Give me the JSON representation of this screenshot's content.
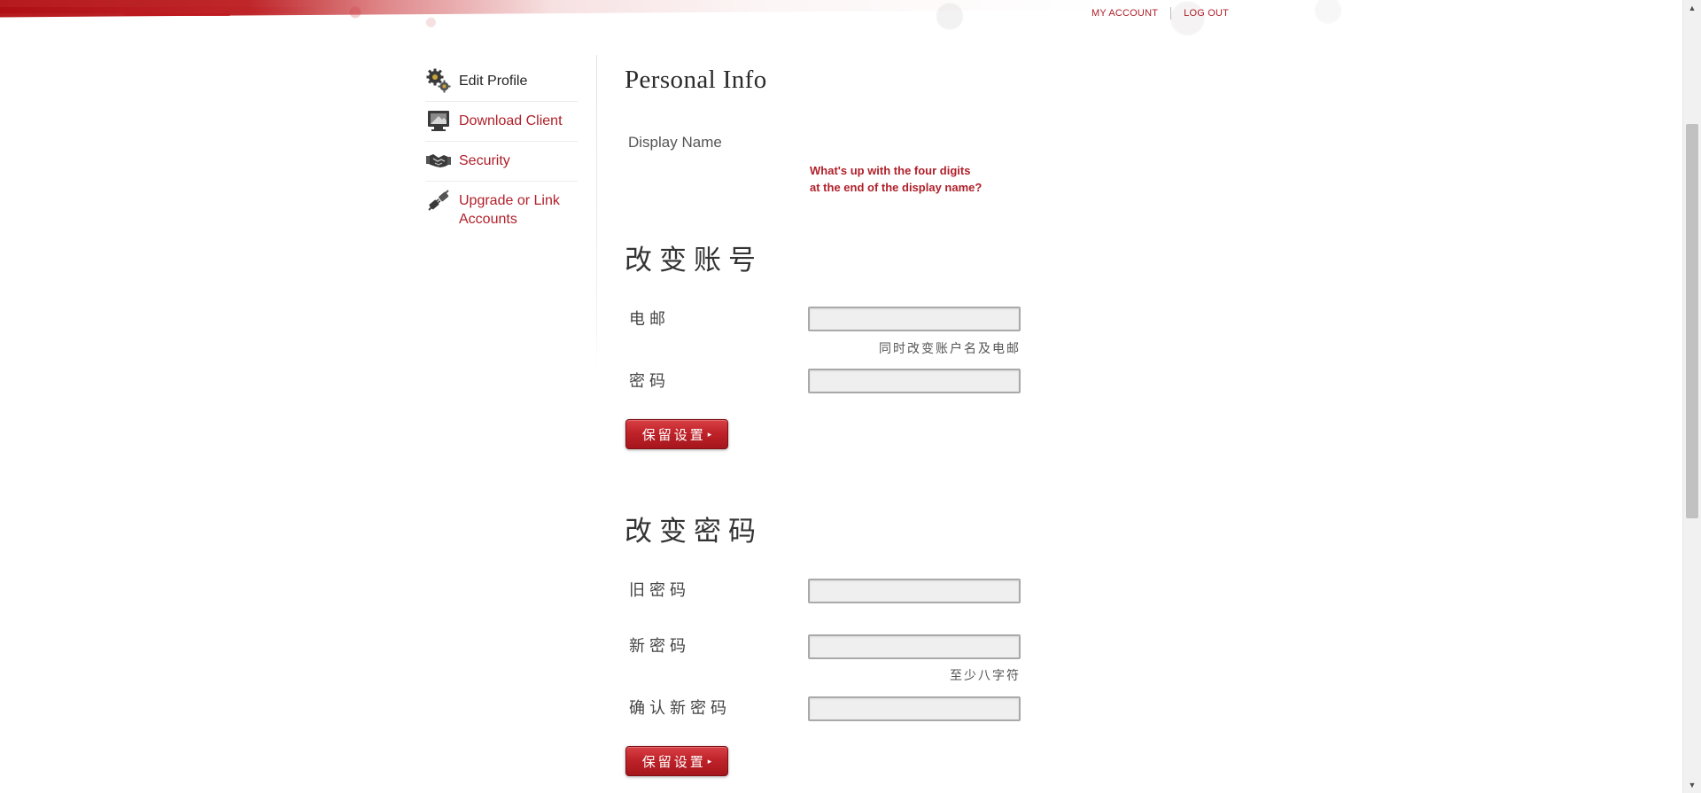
{
  "header": {
    "my_account": "MY ACCOUNT",
    "log_out": "LOG OUT"
  },
  "sidebar": {
    "items": [
      {
        "label": "Edit Profile",
        "icon": "gears-icon",
        "active": true
      },
      {
        "label": "Download Client",
        "icon": "monitor-download-icon",
        "active": false
      },
      {
        "label": "Security",
        "icon": "handshake-icon",
        "active": false
      },
      {
        "label": "Upgrade or Link Accounts",
        "icon": "linked-plugs-icon",
        "active": false
      }
    ]
  },
  "personal_info": {
    "title": "Personal Info",
    "display_name_label": "Display Name",
    "help_line1": "What's up with the four digits",
    "help_line2": "at the end of the display name?"
  },
  "change_account": {
    "title": "改变账号",
    "email_label": "电邮",
    "email_value": "",
    "email_hint": "同时改变账户名及电邮",
    "password_label": "密码",
    "password_value": "",
    "save_label": "保留设置"
  },
  "change_password": {
    "title": "改变密码",
    "old_label": "旧密码",
    "old_value": "",
    "new_label": "新密码",
    "new_value": "",
    "new_hint": "至少八字符",
    "confirm_label": "确认新密码",
    "confirm_value": "",
    "save_label": "保留设置"
  },
  "colors": {
    "accent": "#b0202a",
    "button": "#c0232a",
    "text": "#333333"
  }
}
